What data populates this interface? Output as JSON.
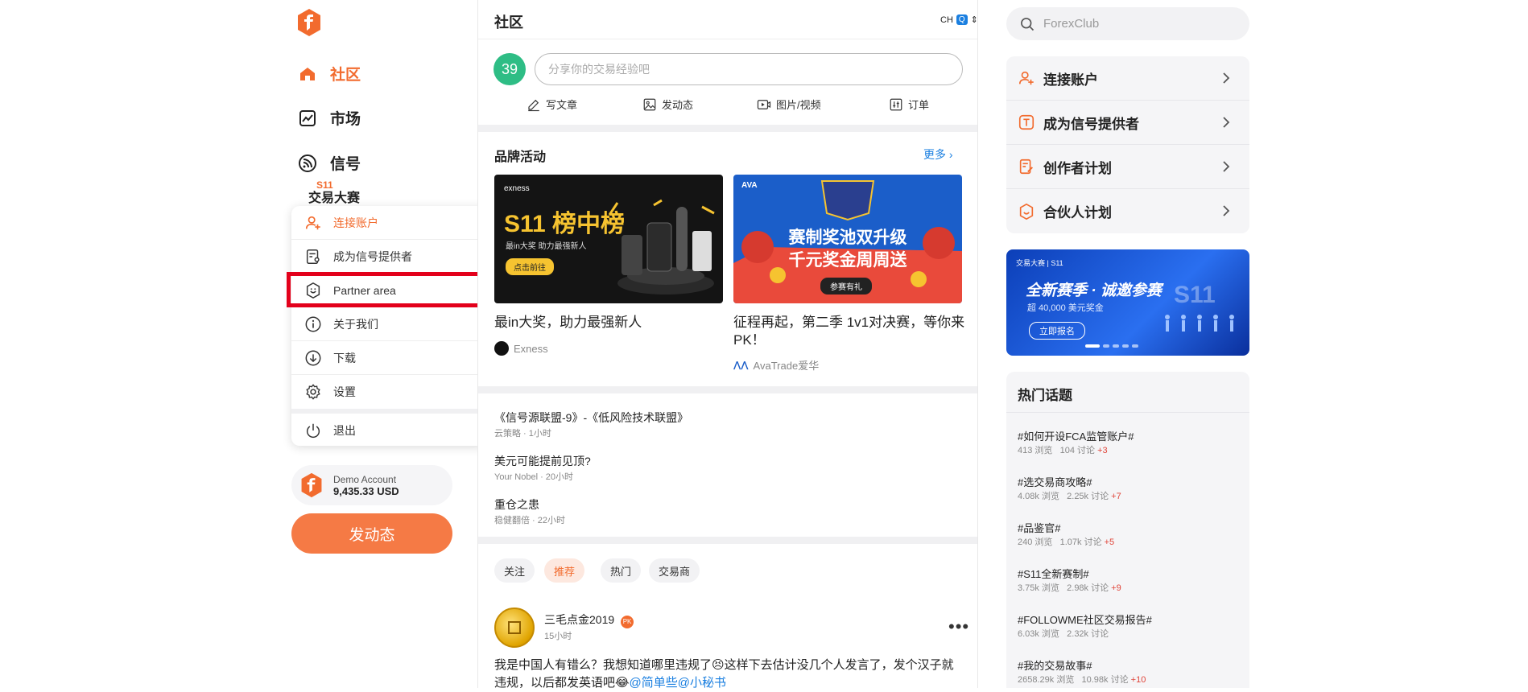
{
  "sidebar": {
    "nav": [
      {
        "label": "社区"
      },
      {
        "label": "市场"
      },
      {
        "label": "信号"
      }
    ],
    "peek_label": "交易大赛",
    "menu": [
      {
        "label": "连接账户"
      },
      {
        "label": "成为信号提供者"
      },
      {
        "label": "Partner area"
      },
      {
        "label": "关于我们"
      },
      {
        "label": "下载"
      },
      {
        "label": "设置"
      },
      {
        "label": "退出"
      }
    ],
    "demo": {
      "label": "Demo Account",
      "balance": "9,435.33 USD"
    },
    "post_button": "发动态"
  },
  "center": {
    "title": "社区",
    "lang": "CH",
    "lang_q": "Q",
    "user_badge": "39",
    "compose_placeholder": "分享你的交易经验吧",
    "actions": [
      "写文章",
      "发动态",
      "图片/视频",
      "订单"
    ],
    "brand": {
      "title": "品牌活动",
      "more": "更多",
      "cards": [
        {
          "title": "最in大奖，助力最强新人",
          "source": "Exness",
          "img_brand": "exness",
          "img_headline": "S11 榜中榜",
          "img_sub": "最in大奖 助力最强新人",
          "img_btn": "点击前往"
        },
        {
          "title": "征程再起，第二季 1v1对决赛，等你来PK！",
          "source": "AvaTrade爱华",
          "img_brand": "AVA",
          "img_headline": "赛制奖池双升级",
          "img_headline2": "千元奖金周周送",
          "img_btn": "参赛有礼"
        }
      ]
    },
    "articles": [
      {
        "title": "《信号源联盟-9》-《低风险技术联盟》",
        "meta": "云策略 · 1小时"
      },
      {
        "title": "美元可能提前见顶?",
        "meta": "Your Nobel · 20小时"
      },
      {
        "title": "重仓之患",
        "meta": "稳健翻倍 · 22小时"
      }
    ],
    "tabs": [
      "关注",
      "推荐",
      "热门",
      "交易商"
    ],
    "post": {
      "author": "三毛点金2019",
      "badge": "PK",
      "time": "15小时",
      "text_line1": "我是中国人有错么？我想知道哪里违规了😣这样下去估计没几个人发言了，发个汉子就",
      "text_line2_a": "违规，以后都发英语吧😂",
      "text_line2_b": "@简单些@小秘书"
    }
  },
  "right": {
    "search_placeholder": "ForexClub",
    "panel": [
      {
        "label": "连接账户"
      },
      {
        "label": "成为信号提供者"
      },
      {
        "label": "创作者计划"
      },
      {
        "label": "合伙人计划"
      }
    ],
    "banner": {
      "brand": "交易大赛 | S11",
      "headline": "全新赛季 · 诚邀参赛",
      "sub": "超 40,000 美元奖金",
      "btn": "立即报名",
      "mark": "S11"
    },
    "hot": {
      "title": "热门话题",
      "topics": [
        {
          "name": "#如何开设FCA监管账户#",
          "views": "413 浏览",
          "discuss": "104 讨论",
          "inc": "+3"
        },
        {
          "name": "#选交易商攻略#",
          "views": "4.08k 浏览",
          "discuss": "2.25k 讨论",
          "inc": "+7"
        },
        {
          "name": "#品鉴官#",
          "views": "240 浏览",
          "discuss": "1.07k 讨论",
          "inc": "+5"
        },
        {
          "name": "#S11全新赛制#",
          "views": "3.75k 浏览",
          "discuss": "2.98k 讨论",
          "inc": "+9"
        },
        {
          "name": "#FOLLOWME社区交易报告#",
          "views": "6.03k 浏览",
          "discuss": "2.32k 讨论",
          "inc": ""
        },
        {
          "name": "#我的交易故事#",
          "views": "2658.29k 浏览",
          "discuss": "10.98k 讨论",
          "inc": "+10"
        }
      ]
    }
  },
  "colors": {
    "accent": "#f26b2e",
    "link": "#1a7fe0",
    "highlight": "#e3001b",
    "badge_green": "#2ebd85"
  }
}
